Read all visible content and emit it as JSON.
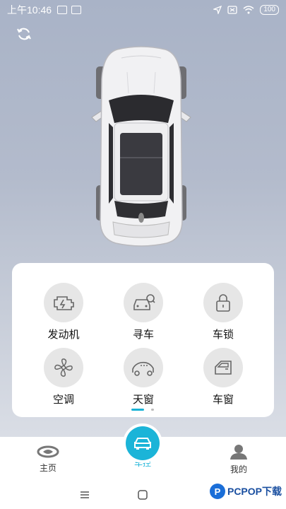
{
  "status_bar": {
    "time": "上午10:46",
    "battery": "100"
  },
  "controls": [
    {
      "label": "发动机",
      "icon": "engine-icon"
    },
    {
      "label": "寻车",
      "icon": "find-car-icon"
    },
    {
      "label": "车锁",
      "icon": "lock-icon"
    },
    {
      "label": "空调",
      "icon": "fan-icon"
    },
    {
      "label": "天窗",
      "icon": "sunroof-icon"
    },
    {
      "label": "车窗",
      "icon": "window-icon"
    }
  ],
  "pager": {
    "pages": 2,
    "active": 1
  },
  "tabs": [
    {
      "label": "主页",
      "icon": "home-logo-icon"
    },
    {
      "label": "车控",
      "icon": "car-icon",
      "active": true
    },
    {
      "label": "我的",
      "icon": "user-icon"
    }
  ],
  "watermark": {
    "text": "PCPOP下载",
    "logo": "P"
  },
  "colors": {
    "accent": "#1bb4d8",
    "panel": "#ffffff",
    "icon_bg": "#e6e6e6"
  }
}
